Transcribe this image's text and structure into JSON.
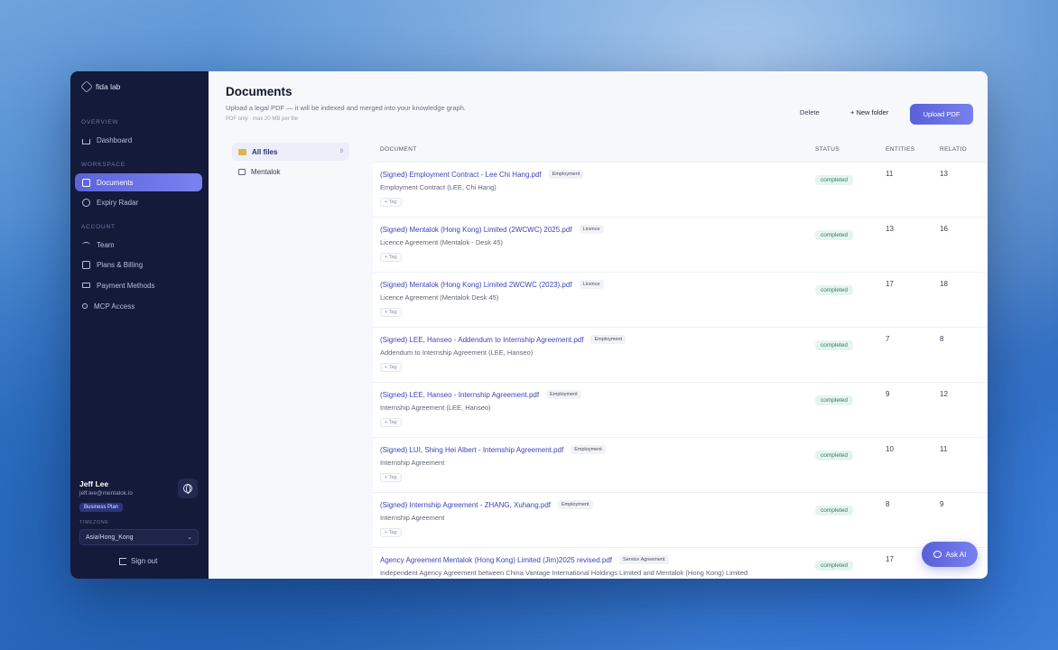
{
  "sidebar": {
    "brand": "fida lab",
    "sections": {
      "overview": "OVERVIEW",
      "workspace": "WORKSPACE",
      "account": "ACCOUNT"
    },
    "items": [
      {
        "label": "Dashboard",
        "icon": "home-icon"
      },
      {
        "label": "Documents",
        "icon": "document-icon"
      },
      {
        "label": "Expiry Radar",
        "icon": "clock-icon"
      },
      {
        "label": "Team",
        "icon": "team-icon"
      },
      {
        "label": "Plans & Billing",
        "icon": "billing-icon"
      },
      {
        "label": "Payment Methods",
        "icon": "card-icon"
      },
      {
        "label": "MCP Access",
        "icon": "key-icon"
      }
    ],
    "user": {
      "name": "Jeff Lee",
      "email": "jeff.lee@mentalok.io",
      "plan": "Business Plan"
    },
    "timezone": {
      "label": "TIMEZONE",
      "value": "Asia/Hong_Kong"
    },
    "signout": "Sign out"
  },
  "header": {
    "title": "Documents",
    "subtitle": "Upload a legal PDF — it will be indexed and merged into your knowledge graph.",
    "note": "PDF only · max 20 MB per file",
    "delete_label": "Delete",
    "new_folder_label": "+ New folder",
    "upload_label": "Upload PDF"
  },
  "folders": [
    {
      "label": "All files",
      "count": "9"
    },
    {
      "label": "Mentalok",
      "count": ""
    }
  ],
  "table": {
    "columns": [
      "DOCUMENT",
      "STATUS",
      "ENTITIES",
      "RELATIO"
    ],
    "tag_label": "+ Tag",
    "rows": [
      {
        "title": "(Signed) Employment Contract - Lee Chi Hang.pdf",
        "category": "Employment",
        "subtitle": "Employment Contract (LEE, Chi Hang)",
        "status": "completed",
        "entities": "11",
        "relations": "13"
      },
      {
        "title": "(Signed) Mentalok (Hong Kong) Limited (2WCWC) 2025.pdf",
        "category": "Licence",
        "subtitle": "Licence Agreement (Mentalok - Desk 45)",
        "status": "completed",
        "entities": "13",
        "relations": "16"
      },
      {
        "title": "(Signed) Mentalok (Hong Kong) Limited 2WCWC (2023).pdf",
        "category": "Licence",
        "subtitle": "Licence Agreement (Mentalok   Desk 45)",
        "status": "completed",
        "entities": "17",
        "relations": "18"
      },
      {
        "title": "(Signed) LEE, Hanseo - Addendum to Internship Agreement.pdf",
        "category": "Employment",
        "subtitle": "Addendum to Internship Agreement (LEE, Hanseo)",
        "status": "completed",
        "entities": "7",
        "relations": "8"
      },
      {
        "title": "(Signed) LEE, Hanseo - Internship Agreement.pdf",
        "category": "Employment",
        "subtitle": "Internship Agreement (LEE, Hanseo)",
        "status": "completed",
        "entities": "9",
        "relations": "12"
      },
      {
        "title": "(Signed) LUI, Shing Hei Albert - Internship Agreement.pdf",
        "category": "Employment",
        "subtitle": "Internship Agreement",
        "status": "completed",
        "entities": "10",
        "relations": "11"
      },
      {
        "title": "(Signed) Internship Agreement - ZHANG, Xuhang.pdf",
        "category": "Employment",
        "subtitle": "Internship Agreement",
        "status": "completed",
        "entities": "8",
        "relations": "9"
      },
      {
        "title": "Agency Agreement Mentalok (Hong Kong) Limited (Jim)2025 revised.pdf",
        "category": "Service Agreement",
        "subtitle": "Independent Agency Agreement between China Vantage International Holdings Limited and Mentalok (Hong Kong) Limited",
        "status": "completed",
        "entities": "17",
        "relations": ""
      }
    ]
  },
  "ask_ai_label": "Ask AI"
}
